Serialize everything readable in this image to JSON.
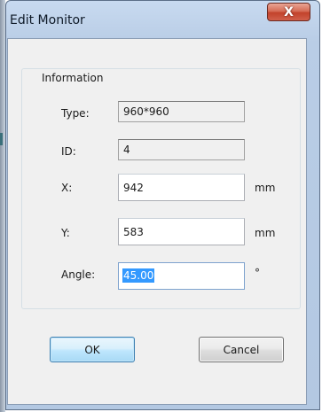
{
  "window": {
    "title": "Edit Monitor",
    "close_symbol": "X"
  },
  "group": {
    "legend": "Information"
  },
  "fields": {
    "type": {
      "label": "Type:",
      "value": "960*960",
      "readonly": true
    },
    "id": {
      "label": "ID:",
      "value": "4",
      "readonly": true
    },
    "x": {
      "label": "X:",
      "value": "942",
      "unit": "mm"
    },
    "y": {
      "label": "Y:",
      "value": "583",
      "unit": "mm"
    },
    "angle": {
      "label": "Angle:",
      "value": "45.00",
      "unit": "°",
      "selected": true
    }
  },
  "buttons": {
    "ok": "OK",
    "cancel": "Cancel"
  },
  "icons": {
    "close": "close-icon"
  },
  "colors": {
    "title_bar": "#b9cde6",
    "client_bg": "#f0f0f0",
    "close_button": "#c2422b",
    "selection": "#3399ff",
    "ok_border": "#3c7fb1"
  }
}
